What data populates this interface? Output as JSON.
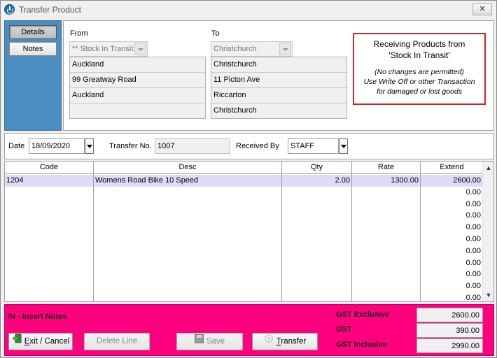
{
  "window": {
    "title": "Transfer Product",
    "close_label": "✕"
  },
  "side": {
    "details_label": "Details",
    "notes_label": "Notes"
  },
  "from": {
    "label": "From",
    "location": "** Stock In Transit",
    "lines": [
      "Auckland",
      "99 Greatway Road",
      "Auckland",
      ""
    ]
  },
  "to": {
    "label": "To",
    "location": "Christchurch",
    "lines": [
      "Christchurch",
      "11 Picton Ave",
      "Riccarton",
      "Christchurch"
    ]
  },
  "notice": {
    "line1": "Receiving Products from",
    "line2": "'Stock In Transit'",
    "sub1": "(No changes are permitted)",
    "sub2": "Use Write Off or other Transaction",
    "sub3": "for damaged or lost goods",
    "border_color": "#d42020"
  },
  "form": {
    "date_label": "Date",
    "date_value": "18/09/2020",
    "transfer_no_label": "Transfer No.",
    "transfer_no_value": "1007",
    "received_by_label": "Received By",
    "received_by_value": "STAFF"
  },
  "grid": {
    "headers": [
      "Code",
      "Desc",
      "Qty",
      "Rate",
      "Extend"
    ],
    "rows": [
      {
        "code": "1204",
        "desc": "Womens Road Bike 10 Speed",
        "qty": "2.00",
        "rate": "1300.00",
        "extend": "2600.00"
      },
      {
        "code": "",
        "desc": "",
        "qty": "",
        "rate": "",
        "extend": "0.00"
      },
      {
        "code": "",
        "desc": "",
        "qty": "",
        "rate": "",
        "extend": "0.00"
      },
      {
        "code": "",
        "desc": "",
        "qty": "",
        "rate": "",
        "extend": "0.00"
      },
      {
        "code": "",
        "desc": "",
        "qty": "",
        "rate": "",
        "extend": "0.00"
      },
      {
        "code": "",
        "desc": "",
        "qty": "",
        "rate": "",
        "extend": "0.00"
      },
      {
        "code": "",
        "desc": "",
        "qty": "",
        "rate": "",
        "extend": "0.00"
      },
      {
        "code": "",
        "desc": "",
        "qty": "",
        "rate": "",
        "extend": "0.00"
      },
      {
        "code": "",
        "desc": "",
        "qty": "",
        "rate": "",
        "extend": "0.00"
      },
      {
        "code": "",
        "desc": "",
        "qty": "",
        "rate": "",
        "extend": "0.00"
      },
      {
        "code": "",
        "desc": "",
        "qty": "",
        "rate": "",
        "extend": "0.00"
      }
    ]
  },
  "footer": {
    "insert_notes": "/N - Insert Notes",
    "exit_label": "Exit / Cancel",
    "delete_label": "Delete Line",
    "save_label": "Save",
    "transfer_label": "Transfer",
    "gst_excl_label": "GST Exclusive",
    "gst_excl_value": "2600.00",
    "gst_label": "GST",
    "gst_value": "390.00",
    "gst_incl_label": "GST Inclusive",
    "gst_incl_value": "2990.00",
    "bg_color": "#ff007f"
  }
}
